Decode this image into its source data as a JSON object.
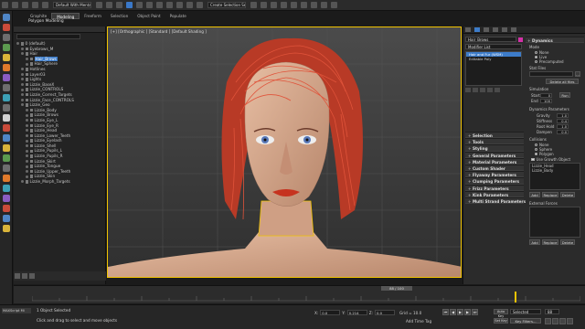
{
  "menubar": {
    "workspace_field": "Default With Mental Ray",
    "selection_set_field": "Create Selection Se"
  },
  "ribbon": {
    "tabs": [
      "Graphite",
      "Modeling",
      "Freeform",
      "Selection",
      "Object Paint",
      "Populate"
    ],
    "active_tab_index": 1,
    "sub_label": "Polygon Modeling"
  },
  "scene_explorer": {
    "items": [
      {
        "label": "0 (default)",
        "depth": 0
      },
      {
        "label": "Eyebrows_M",
        "depth": 1
      },
      {
        "label": "Hair",
        "depth": 1
      },
      {
        "label": "Hair_Brows",
        "depth": 2,
        "selected": true
      },
      {
        "label": "Hair_Sphere",
        "depth": 2
      },
      {
        "label": "Hotlines",
        "depth": 1
      },
      {
        "label": "Layer03",
        "depth": 1
      },
      {
        "label": "Lights",
        "depth": 1
      },
      {
        "label": "Lizzie_BaseX",
        "depth": 1
      },
      {
        "label": "Lizzie_CONTROLS",
        "depth": 1
      },
      {
        "label": "Lizzie_Correct_Targets",
        "depth": 1
      },
      {
        "label": "Lizzie_Face_CONTROLS",
        "depth": 1
      },
      {
        "label": "Lizzie_Geo",
        "depth": 1
      },
      {
        "label": "Lizzie_Body",
        "depth": 2
      },
      {
        "label": "Lizzie_Brows",
        "depth": 2
      },
      {
        "label": "Lizzie_Eye_L",
        "depth": 2
      },
      {
        "label": "Lizzie_Eye_R",
        "depth": 2
      },
      {
        "label": "Lizzie_Head",
        "depth": 2
      },
      {
        "label": "Lizzie_Lower_Teeth",
        "depth": 2
      },
      {
        "label": "Lizzie_Eyelash",
        "depth": 2
      },
      {
        "label": "Lizzie_Shell",
        "depth": 2
      },
      {
        "label": "Lizzie_Pupils_L",
        "depth": 2
      },
      {
        "label": "Lizzie_Pupils_R",
        "depth": 2
      },
      {
        "label": "Lizzie_Skirt",
        "depth": 2
      },
      {
        "label": "Lizzie_Tongue",
        "depth": 2
      },
      {
        "label": "Lizzie_Upper_Teeth",
        "depth": 2
      },
      {
        "label": "Lizzie_Skin",
        "depth": 2
      },
      {
        "label": "Lizzie_Morph_Targets",
        "depth": 1
      }
    ]
  },
  "viewport": {
    "label": "[+] [Orthographic ] [Standard ] [Default Shading ]"
  },
  "command_panel": {
    "object_name": "Hair_Brows",
    "modifier_list_label": "Modifier List",
    "stack_items": [
      "Hair and Fur (WSM)",
      "Editable Poly"
    ],
    "rollouts": [
      "Selection",
      "Tools",
      "Styling",
      "General Parameters",
      "Material Parameters",
      "Custom Shader",
      "Flyaway Parameters",
      "Clumping Parameters",
      "Frizz Parameters",
      "Kink Parameters",
      "Multi Strand Parameters"
    ],
    "dynamics": {
      "title": "Dynamics",
      "mode_label": "Mode",
      "modes": [
        {
          "label": "None",
          "on": false
        },
        {
          "label": "Live",
          "on": true
        },
        {
          "label": "Precomputed",
          "on": false
        }
      ],
      "stat_files_label": "Stat Files",
      "delete_all_files": "Delete all files",
      "simulation_label": "Simulation",
      "start_label": "Start",
      "start_value": "0",
      "end_label": "End",
      "end_value": "100",
      "run_label": "Run",
      "params_label": "Dynamics Parameters",
      "gravity_label": "Gravity",
      "gravity_value": "1.0",
      "stiffness_label": "Stiffness",
      "stiffness_value": "0.4",
      "root_hold_label": "Root Hold",
      "root_hold_value": "1.0",
      "dampen_label": "Dampen",
      "dampen_value": "0.0",
      "collisions_label": "Collisions",
      "collision_modes": [
        {
          "label": "None",
          "on": false
        },
        {
          "label": "Sphere",
          "on": false
        },
        {
          "label": "Polygon",
          "on": true
        }
      ],
      "use_growth_object": "Use Growth Object",
      "collision_list": [
        "Lizzie_Head",
        "Lizzie_Body"
      ],
      "add_label": "Add",
      "replace_label": "Replace",
      "delete_label": "Delete",
      "external_forces_label": "External Forces"
    }
  },
  "timeline": {
    "slider_label": "88 / 100",
    "current_frame_fraction": 0.88
  },
  "statusbar": {
    "selection_status": "1 Object Selected",
    "prompt": "Click and drag to select and move objects",
    "x_label": "X:",
    "x_value": "0.0",
    "y_label": "Y:",
    "y_value": "0.214",
    "z_label": "Z:",
    "z_value": "0.0",
    "grid_label": "Grid = 10.0",
    "add_time_tag": "Add Time Tag",
    "auto_key": "Auto Key",
    "set_key": "Set Key",
    "key_filters": "Key Filters...",
    "selected_field": "Selected",
    "frame_field": "88",
    "maxscript_label": "MAXScript Mi"
  },
  "colors": {
    "accent_blue": "#3d7cc9",
    "viewport_border": "#f0c300",
    "hair_red": "#d84a2e",
    "skin": "#d7a78a"
  }
}
